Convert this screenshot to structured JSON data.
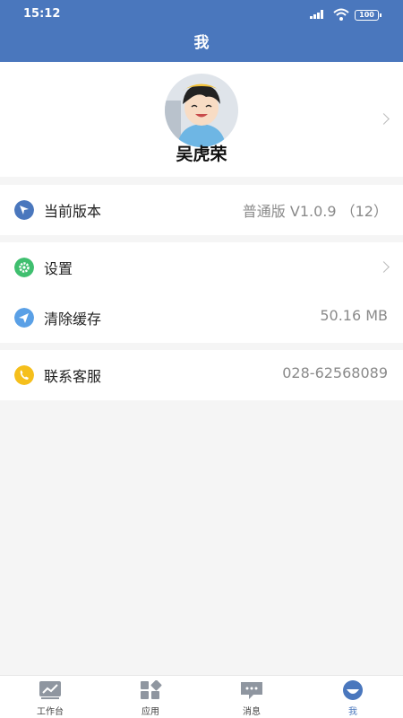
{
  "status_bar": {
    "time": "15:12",
    "battery": "100"
  },
  "header": {
    "title": "我"
  },
  "profile": {
    "name": "吴虎荣"
  },
  "version": {
    "label": "当前版本",
    "value": "普通版 V1.0.9 （12）"
  },
  "settings": {
    "label": "设置"
  },
  "cache": {
    "label": "清除缓存",
    "value": "50.16 MB"
  },
  "support": {
    "label": "联系客服",
    "value": "028-62568089"
  },
  "tabs": [
    {
      "label": "工作台",
      "icon": "workbench-icon"
    },
    {
      "label": "应用",
      "icon": "apps-icon"
    },
    {
      "label": "消息",
      "icon": "message-icon"
    },
    {
      "label": "我",
      "icon": "me-icon"
    }
  ],
  "colors": {
    "primary": "#4a77bd",
    "background": "#f5f5f5",
    "settings_icon": "#3fbf6f",
    "support_icon": "#f5bf1c"
  }
}
